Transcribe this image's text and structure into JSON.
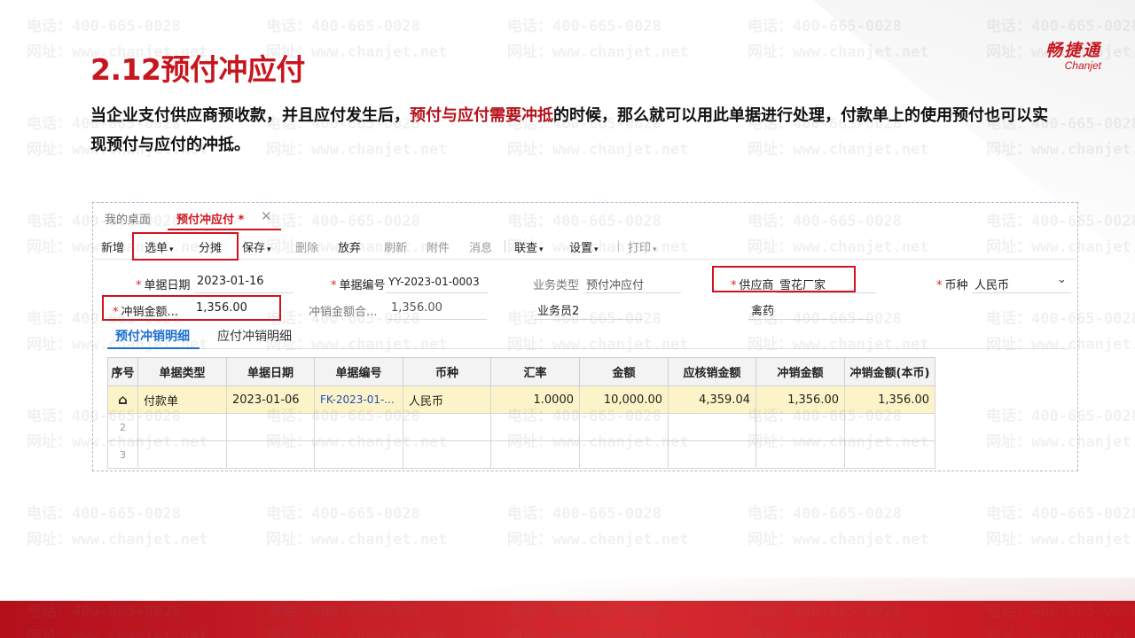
{
  "watermark": {
    "phone": "电话：400-665-0028",
    "site": "网址：www.chanjet.net"
  },
  "logo": {
    "cn": "畅捷通",
    "en": "Chanjet"
  },
  "slide": {
    "title": "2.12预付冲应付",
    "intro_part1": "当企业支付供应商预收款，并且应付发生后，",
    "intro_highlight": "预付与应付需要冲抵",
    "intro_part2": "的时候，那么就可以用此单据进行处理，付款单上的使用预付也可以实现预付与应付的冲抵。"
  },
  "app": {
    "tabs": {
      "desk": "我的桌面",
      "active": "预付冲应付 *",
      "close": "✕"
    },
    "toolbar": {
      "new": "新增",
      "select": "选单",
      "allocate": "分摊",
      "save": "保存",
      "delete": "删除",
      "abandon": "放弃",
      "refresh": "刷新",
      "attachment": "附件",
      "message": "消息",
      "linked": "联查",
      "settings": "设置",
      "print": "打印",
      "caret": "▾"
    },
    "form": {
      "date_label": "单据日期",
      "date_value": "2023-01-16",
      "code_label": "单据编号",
      "code_value": "YY-2023-01-0003",
      "biz_type_label": "业务类型",
      "biz_type_value": "预付冲应付",
      "supplier_label": "供应商",
      "supplier_value": "雪花厂家",
      "currency_label": "币种",
      "currency_value": "人民币",
      "offset_amount_label": "冲销金额...",
      "offset_amount_value": "1,356.00",
      "offset_total_label": "冲销金额合...",
      "offset_total_value": "1,356.00",
      "salesman_value": "业务员2",
      "dept_value": "禽药",
      "required_mark": "*"
    },
    "subtabs": {
      "prepay": "预付冲销明细",
      "payable": "应付冲销明细"
    },
    "table": {
      "columns": [
        "序号",
        "单据类型",
        "单据日期",
        "单据编号",
        "币种",
        "汇率",
        "金额",
        "应核销金额",
        "冲销金额",
        "冲销金额(本币)"
      ],
      "rows": [
        {
          "idx": "⌂",
          "type": "付款单",
          "date": "2023-01-06",
          "code": "FK-2023-01-...",
          "currency": "人民币",
          "rate": "1.0000",
          "amount": "10,000.00",
          "due": "4,359.04",
          "offset": "1,356.00",
          "offset_local": "1,356.00"
        },
        {
          "idx": "2",
          "type": "",
          "date": "",
          "code": "",
          "currency": "",
          "rate": "",
          "amount": "",
          "due": "",
          "offset": "",
          "offset_local": ""
        },
        {
          "idx": "3",
          "type": "",
          "date": "",
          "code": "",
          "currency": "",
          "rate": "",
          "amount": "",
          "due": "",
          "offset": "",
          "offset_local": ""
        }
      ]
    }
  },
  "colors": {
    "brand_red": "#c8161e",
    "link_blue": "#1a6fd1",
    "selected_row": "#fdf3c8"
  }
}
